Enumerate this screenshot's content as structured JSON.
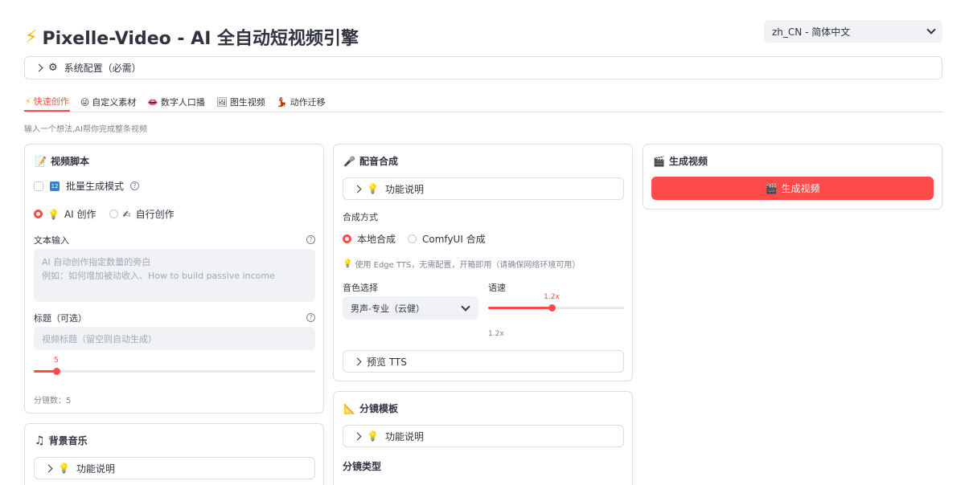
{
  "header": {
    "title": "Pixelle-Video - AI 全自动短视频引擎",
    "language": "zh_CN - 简体中文"
  },
  "system_config": {
    "label": "系统配置（必需）"
  },
  "tabs": [
    {
      "icon": "⚡",
      "label": "快速创作",
      "active": true
    },
    {
      "icon": "😜",
      "label": "自定义素材",
      "active": false
    },
    {
      "icon": "👄",
      "label": "数字人口播",
      "active": false
    },
    {
      "icon": "🖼",
      "label": "图生视频",
      "active": false
    },
    {
      "icon": "💃",
      "label": "动作迁移",
      "active": false
    }
  ],
  "subtitle": "输入一个想法,AI帮你完成整条视频",
  "script_card": {
    "title": "视频脚本",
    "batch_label": "批量生成模式",
    "mode_ai": "AI 创作",
    "mode_self": "自行创作",
    "text_input_label": "文本输入",
    "text_input_placeholder_line1": "AI 自动创作指定数量的旁白",
    "text_input_placeholder_line2": "例如：如何增加被动收入、How to build passive income",
    "title_label": "标题（可选）",
    "title_placeholder": "视频标题（留空则自动生成）",
    "scenes_value": "5",
    "scenes_fraction": 0.08,
    "scenes_text": "分镜数：5"
  },
  "bgm_card": {
    "title": "背景音乐",
    "help_label": "功能说明"
  },
  "voice_card": {
    "title": "配音合成",
    "help_label": "功能说明",
    "method_label": "合成方式",
    "method_local": "本地合成",
    "method_comfy": "ComfyUI 合成",
    "hint": "使用 Edge TTS，无需配置，开箱即用（请确保网络环境可用）",
    "voice_label": "音色选择",
    "voice_value": "男声-专业（云健）",
    "speed_label": "语速",
    "speed_value": "1.2x",
    "speed_fraction": 0.47,
    "speed_text": "1.2x",
    "preview_label": "预览 TTS"
  },
  "template_card": {
    "title": "分镜模板",
    "help_label": "功能说明",
    "type_label": "分镜类型"
  },
  "generate_card": {
    "title": "生成视频",
    "button_label": "生成视频"
  },
  "colors": {
    "accent": "#ff4b4b",
    "input_bg": "#f0f2f6",
    "border": "#dcdee4",
    "text": "#31333f"
  }
}
